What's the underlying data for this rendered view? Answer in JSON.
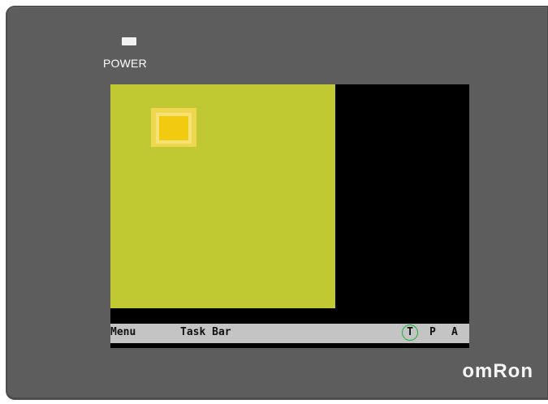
{
  "device": {
    "power_label": "POWER",
    "brand": "omRon",
    "colors": {
      "bezel": "#5d5d5d",
      "screen": "#000000",
      "panel": "#c0c832",
      "lamp": "#f2ca10",
      "taskbar": "#c4c4c4",
      "status_ring": "#18b538"
    }
  },
  "screen": {
    "taskbar": {
      "menu_label": "Menu",
      "taskbar_label": "Task Bar",
      "status_t": "T",
      "status_p": "P",
      "status_a": "A"
    }
  }
}
